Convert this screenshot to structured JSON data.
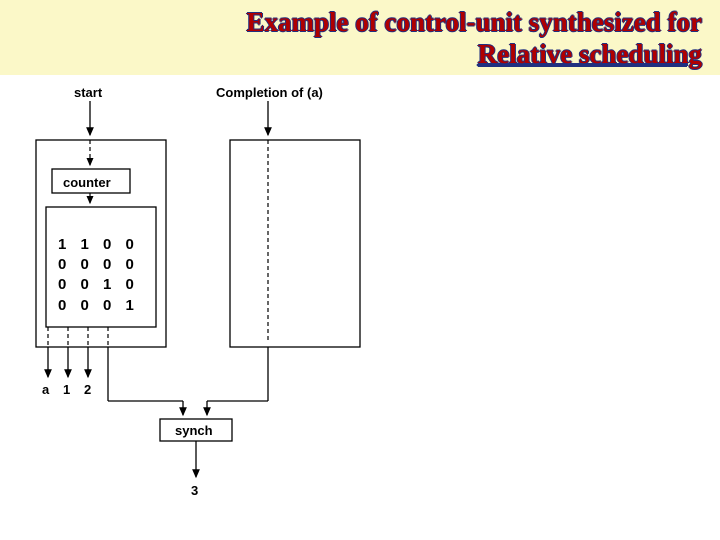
{
  "title": {
    "line1": "Example of control-unit synthesized for",
    "line2": "Relative scheduling"
  },
  "labels": {
    "start": "start",
    "completion": "Completion of (a)",
    "counter": "counter",
    "synch": "synch",
    "out_a": "a",
    "out_1": "1",
    "out_2": "2",
    "out_3": "3"
  },
  "matrix": {
    "r0": "1 1 0 0",
    "r1": "0 0 0 0",
    "r2": "0 0 1 0",
    "r3": "0 0 0 1"
  }
}
